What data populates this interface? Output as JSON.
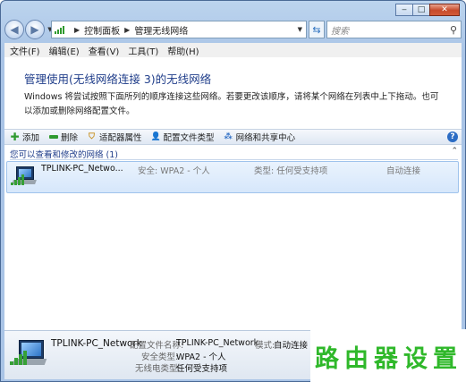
{
  "window": {
    "controls": {
      "minimize": "‒",
      "maximize": "□",
      "close": "✕"
    }
  },
  "navbar": {
    "breadcrumb": [
      "控制面板",
      "管理无线网络"
    ],
    "search_placeholder": "搜索"
  },
  "menu": [
    "文件(F)",
    "编辑(E)",
    "查看(V)",
    "工具(T)",
    "帮助(H)"
  ],
  "main": {
    "heading": "管理使用(无线网络连接 3)的无线网络",
    "description": "Windows 将尝试按照下面所列的顺序连接这些网络。若要更改该顺序，请将某个网络在列表中上下拖动。也可以添加或删除网络配置文件。"
  },
  "toolbar": {
    "items": [
      {
        "label": "添加",
        "icon": "add-icon"
      },
      {
        "label": "删除",
        "icon": "remove-icon"
      },
      {
        "label": "适配器属性",
        "icon": "adapter-properties-icon"
      },
      {
        "label": "配置文件类型",
        "icon": "profile-type-icon"
      },
      {
        "label": "网络和共享中心",
        "icon": "network-center-icon"
      }
    ],
    "help_icon": "help-icon"
  },
  "group": {
    "title": "您可以查看和修改的网络 (1)"
  },
  "networks": [
    {
      "name": "TPLINK-PC_Netwo...",
      "security": "安全: WPA2 - 个人",
      "type": "类型: 任何受支持项",
      "mode": "自动连接"
    }
  ],
  "details": {
    "name": "TPLINK-PC_Network",
    "profile_label": "配置文件名称:",
    "profile_value": "TPLINK-PC_Network",
    "mode_label": "模式:",
    "mode_value": "自动连接",
    "security_label": "安全类型:",
    "security_value": "WPA2 - 个人",
    "radio_label": "无线电类型:",
    "radio_value": "任何受支持项"
  },
  "watermark": "路由器设置",
  "colors": {
    "heading": "#1f3d8a",
    "selection": "#d6e7fb",
    "watermark": "#2fb82a"
  }
}
